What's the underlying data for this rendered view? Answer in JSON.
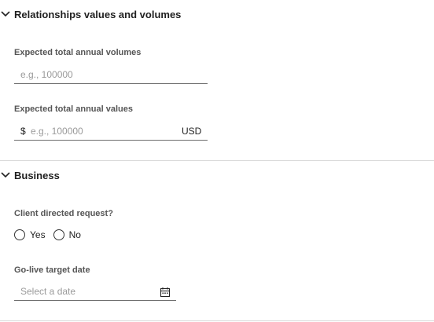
{
  "sections": {
    "relationships": {
      "title": "Relationships values and volumes",
      "volumes_label": "Expected total annual volumes",
      "volumes_placeholder": "e.g., 100000",
      "values_label": "Expected total annual values",
      "values_prefix": "$",
      "values_placeholder": "e.g., 100000",
      "values_suffix": "USD"
    },
    "business": {
      "title": "Business",
      "client_directed_label": "Client directed request?",
      "radio_yes": "Yes",
      "radio_no": "No",
      "golive_label": "Go-live target date",
      "golive_placeholder": "Select a date"
    }
  },
  "icons": {
    "chevron": "chevron-down-icon",
    "calendar": "calendar-icon"
  },
  "colors": {
    "divider": "#d9d9d9",
    "label": "#555555",
    "underline": "#6b6b6b"
  }
}
